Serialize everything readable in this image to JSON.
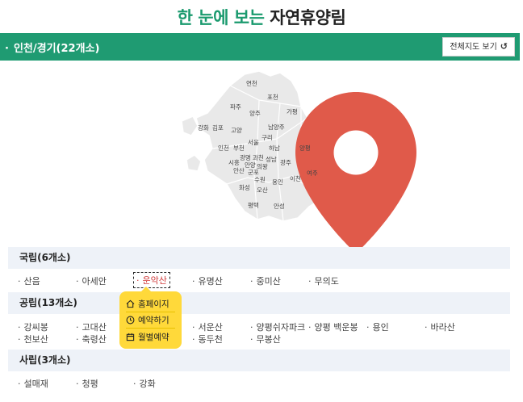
{
  "page_title": {
    "green": "한 눈에 보는",
    "dark": "자연휴양림"
  },
  "region": {
    "title": "인천/경기(22개소)",
    "view_all_label": "전체지도 보기"
  },
  "map": {
    "cities": [
      "연천",
      "포천",
      "파주",
      "양주",
      "가평",
      "강화",
      "김포",
      "고양",
      "남양주",
      "구리",
      "인천",
      "부천",
      "서울",
      "하남",
      "양평",
      "광명",
      "과천",
      "성남",
      "시흥",
      "안양",
      "의왕",
      "광주",
      "여주",
      "안산",
      "군포",
      "수원",
      "용인",
      "이천",
      "화성",
      "오산",
      "평택",
      "안성"
    ]
  },
  "sections": [
    {
      "title": "국립(6개소)",
      "items": [
        "산음",
        "아세안",
        "운악산",
        "유명산",
        "중미산",
        "무의도"
      ]
    },
    {
      "title": "공립(13개소)",
      "items": [
        "강씨봉",
        "고대산",
        "",
        "서운산",
        "양평쉬자파크",
        "양평 백운봉",
        "용인",
        "바라산",
        "천보산",
        "축령산",
        "",
        "동두천",
        "무봉산"
      ]
    },
    {
      "title": "사립(3개소)",
      "items": [
        "설매재",
        "청평",
        "강화"
      ]
    }
  ],
  "popup": {
    "items": [
      "홈페이지",
      "예약하기",
      "월별예약"
    ]
  },
  "colors": {
    "accent": "#1f9b72",
    "popup": "#ffd93a",
    "section_bg": "#eef2f8",
    "pin": "#e05a4a"
  }
}
